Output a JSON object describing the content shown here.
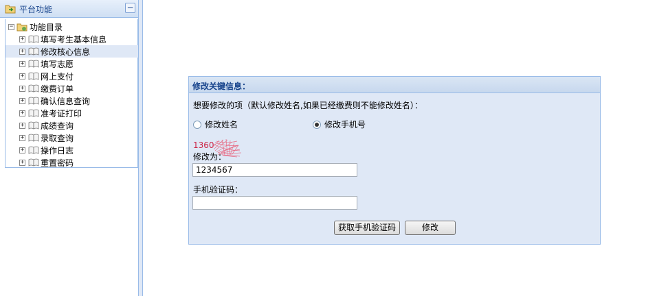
{
  "sidebar": {
    "title": "平台功能",
    "collapse_symbol": "−",
    "tree": {
      "root_label": "功能目录",
      "items": [
        {
          "label": "填写考生基本信息"
        },
        {
          "label": "修改核心信息",
          "selected": true
        },
        {
          "label": "填写志愿"
        },
        {
          "label": "网上支付"
        },
        {
          "label": "缴费订单"
        },
        {
          "label": "确认信息查询"
        },
        {
          "label": "准考证打印"
        },
        {
          "label": "成绩查询"
        },
        {
          "label": "录取查询"
        },
        {
          "label": "操作日志"
        },
        {
          "label": "重置密码"
        }
      ]
    }
  },
  "panel": {
    "title": "修改关键信息：",
    "question": "想要修改的项（默认修改姓名,如果已经缴费则不能修改姓名）：",
    "options": [
      {
        "label": "修改姓名",
        "checked": false
      },
      {
        "label": "修改手机号",
        "checked": true
      }
    ],
    "phone_display": "1360",
    "modify_to_label": "修改为：",
    "modify_to_value": "1234567",
    "verify_code_label": "手机验证码：",
    "verify_code_value": "",
    "get_code_button": "获取手机验证码",
    "submit_button": "修改"
  },
  "colors": {
    "header_text": "#15428b",
    "border": "#99bbe8",
    "panel_bg": "#dfe8f6",
    "phone_text": "#cc2244",
    "captcha_noise": "#e8607a"
  },
  "icons": {
    "header": "folder-arrow-icon",
    "root": "folder-icon",
    "item": "book-icon",
    "expander": "plus-box-icon",
    "root_expander": "minus-box-icon"
  }
}
